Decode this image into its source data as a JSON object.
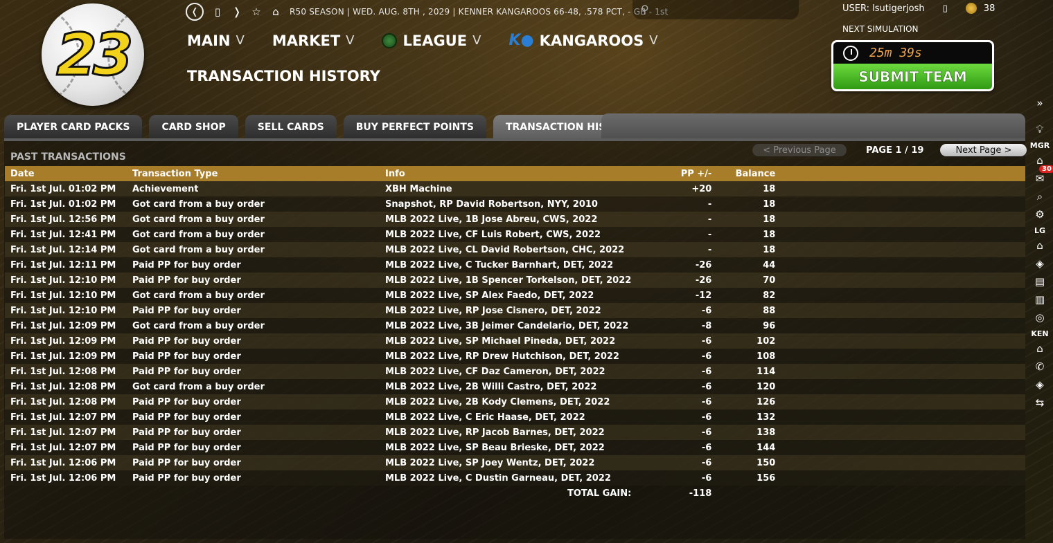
{
  "logo": {
    "number": "23"
  },
  "topbar": {
    "season_info": "R50 SEASON  |  WED. AUG. 8TH , 2029  |  KENNER KANGAROOS   66-48, .578 PCT, - GB - 1st"
  },
  "user": {
    "label": "USER: lsutigerjosh",
    "coins": "38"
  },
  "simulation": {
    "label": "NEXT SIMULATION",
    "time": "25m 39s",
    "submit_label": "SUBMIT TEAM"
  },
  "nav": {
    "main": "MAIN",
    "market": "MARKET",
    "league": "LEAGUE",
    "team": "KANGAROOS",
    "chevron": "V"
  },
  "page_title": "TRANSACTION HISTORY",
  "tabs": [
    {
      "label": "PLAYER CARD PACKS"
    },
    {
      "label": "CARD SHOP"
    },
    {
      "label": "SELL CARDS"
    },
    {
      "label": "BUY PERFECT POINTS"
    },
    {
      "label": "TRANSACTION HISTORY"
    }
  ],
  "section_title": "PAST TRANSACTIONS",
  "pager": {
    "prev": "< Previous Page",
    "page": "PAGE 1 / 19",
    "next": "Next Page >"
  },
  "table": {
    "headers": [
      "Date",
      "Transaction Type",
      "Info",
      "PP +/-",
      "Balance"
    ],
    "rows": [
      [
        "Fri. 1st Jul. 01:02 PM",
        "Achievement",
        "XBH Machine",
        "+20",
        "18"
      ],
      [
        "Fri. 1st Jul. 01:02 PM",
        "Got card from a buy order",
        "Snapshot, RP David Robertson, NYY, 2010",
        "-",
        "18"
      ],
      [
        "Fri. 1st Jul. 12:56 PM",
        "Got card from a buy order",
        "MLB 2022 Live, 1B Jose Abreu, CWS, 2022",
        "-",
        "18"
      ],
      [
        "Fri. 1st Jul. 12:41 PM",
        "Got card from a buy order",
        "MLB 2022 Live, CF Luis Robert, CWS, 2022",
        "-",
        "18"
      ],
      [
        "Fri. 1st Jul. 12:14 PM",
        "Got card from a buy order",
        "MLB 2022 Live, CL David Robertson, CHC, 2022",
        "-",
        "18"
      ],
      [
        "Fri. 1st Jul. 12:11 PM",
        "Paid PP for buy order",
        "MLB 2022 Live, C Tucker Barnhart, DET, 2022",
        "-26",
        "44"
      ],
      [
        "Fri. 1st Jul. 12:10 PM",
        "Paid PP for buy order",
        "MLB 2022 Live, 1B Spencer Torkelson, DET, 2022",
        "-26",
        "70"
      ],
      [
        "Fri. 1st Jul. 12:10 PM",
        "Got card from a buy order",
        "MLB 2022 Live, SP Alex Faedo, DET, 2022",
        "-12",
        "82"
      ],
      [
        "Fri. 1st Jul. 12:10 PM",
        "Paid PP for buy order",
        "MLB 2022 Live, RP Jose Cisnero, DET, 2022",
        "-6",
        "88"
      ],
      [
        "Fri. 1st Jul. 12:09 PM",
        "Got card from a buy order",
        "MLB 2022 Live, 3B Jeimer Candelario, DET, 2022",
        "-8",
        "96"
      ],
      [
        "Fri. 1st Jul. 12:09 PM",
        "Paid PP for buy order",
        "MLB 2022 Live, SP Michael Pineda, DET, 2022",
        "-6",
        "102"
      ],
      [
        "Fri. 1st Jul. 12:09 PM",
        "Paid PP for buy order",
        "MLB 2022 Live, RP Drew Hutchison, DET, 2022",
        "-6",
        "108"
      ],
      [
        "Fri. 1st Jul. 12:08 PM",
        "Paid PP for buy order",
        "MLB 2022 Live, CF Daz Cameron, DET, 2022",
        "-6",
        "114"
      ],
      [
        "Fri. 1st Jul. 12:08 PM",
        "Got card from a buy order",
        "MLB 2022 Live, 2B Willi Castro, DET, 2022",
        "-6",
        "120"
      ],
      [
        "Fri. 1st Jul. 12:08 PM",
        "Paid PP for buy order",
        "MLB 2022 Live, 2B Kody Clemens, DET, 2022",
        "-6",
        "126"
      ],
      [
        "Fri. 1st Jul. 12:07 PM",
        "Paid PP for buy order",
        "MLB 2022 Live, C Eric Haase, DET, 2022",
        "-6",
        "132"
      ],
      [
        "Fri. 1st Jul. 12:07 PM",
        "Paid PP for buy order",
        "MLB 2022 Live, RP Jacob Barnes, DET, 2022",
        "-6",
        "138"
      ],
      [
        "Fri. 1st Jul. 12:07 PM",
        "Paid PP for buy order",
        "MLB 2022 Live, SP Beau Brieske, DET, 2022",
        "-6",
        "144"
      ],
      [
        "Fri. 1st Jul. 12:06 PM",
        "Paid PP for buy order",
        "MLB 2022 Live, SP Joey Wentz, DET, 2022",
        "-6",
        "150"
      ],
      [
        "Fri. 1st Jul. 12:06 PM",
        "Paid PP for buy order",
        "MLB 2022 Live, C Dustin Garneau, DET, 2022",
        "-6",
        "156"
      ]
    ],
    "total_label": "TOTAL GAIN:",
    "total_value": "-118"
  },
  "sidebar": {
    "labels": {
      "mgr": "MGR",
      "lg": "LG",
      "ken": "KEN"
    },
    "mail_badge": "30"
  },
  "colors": {
    "header_gold": "#a87d2a",
    "positive": "#6cd16c",
    "submit_green": "#3fb51f"
  }
}
